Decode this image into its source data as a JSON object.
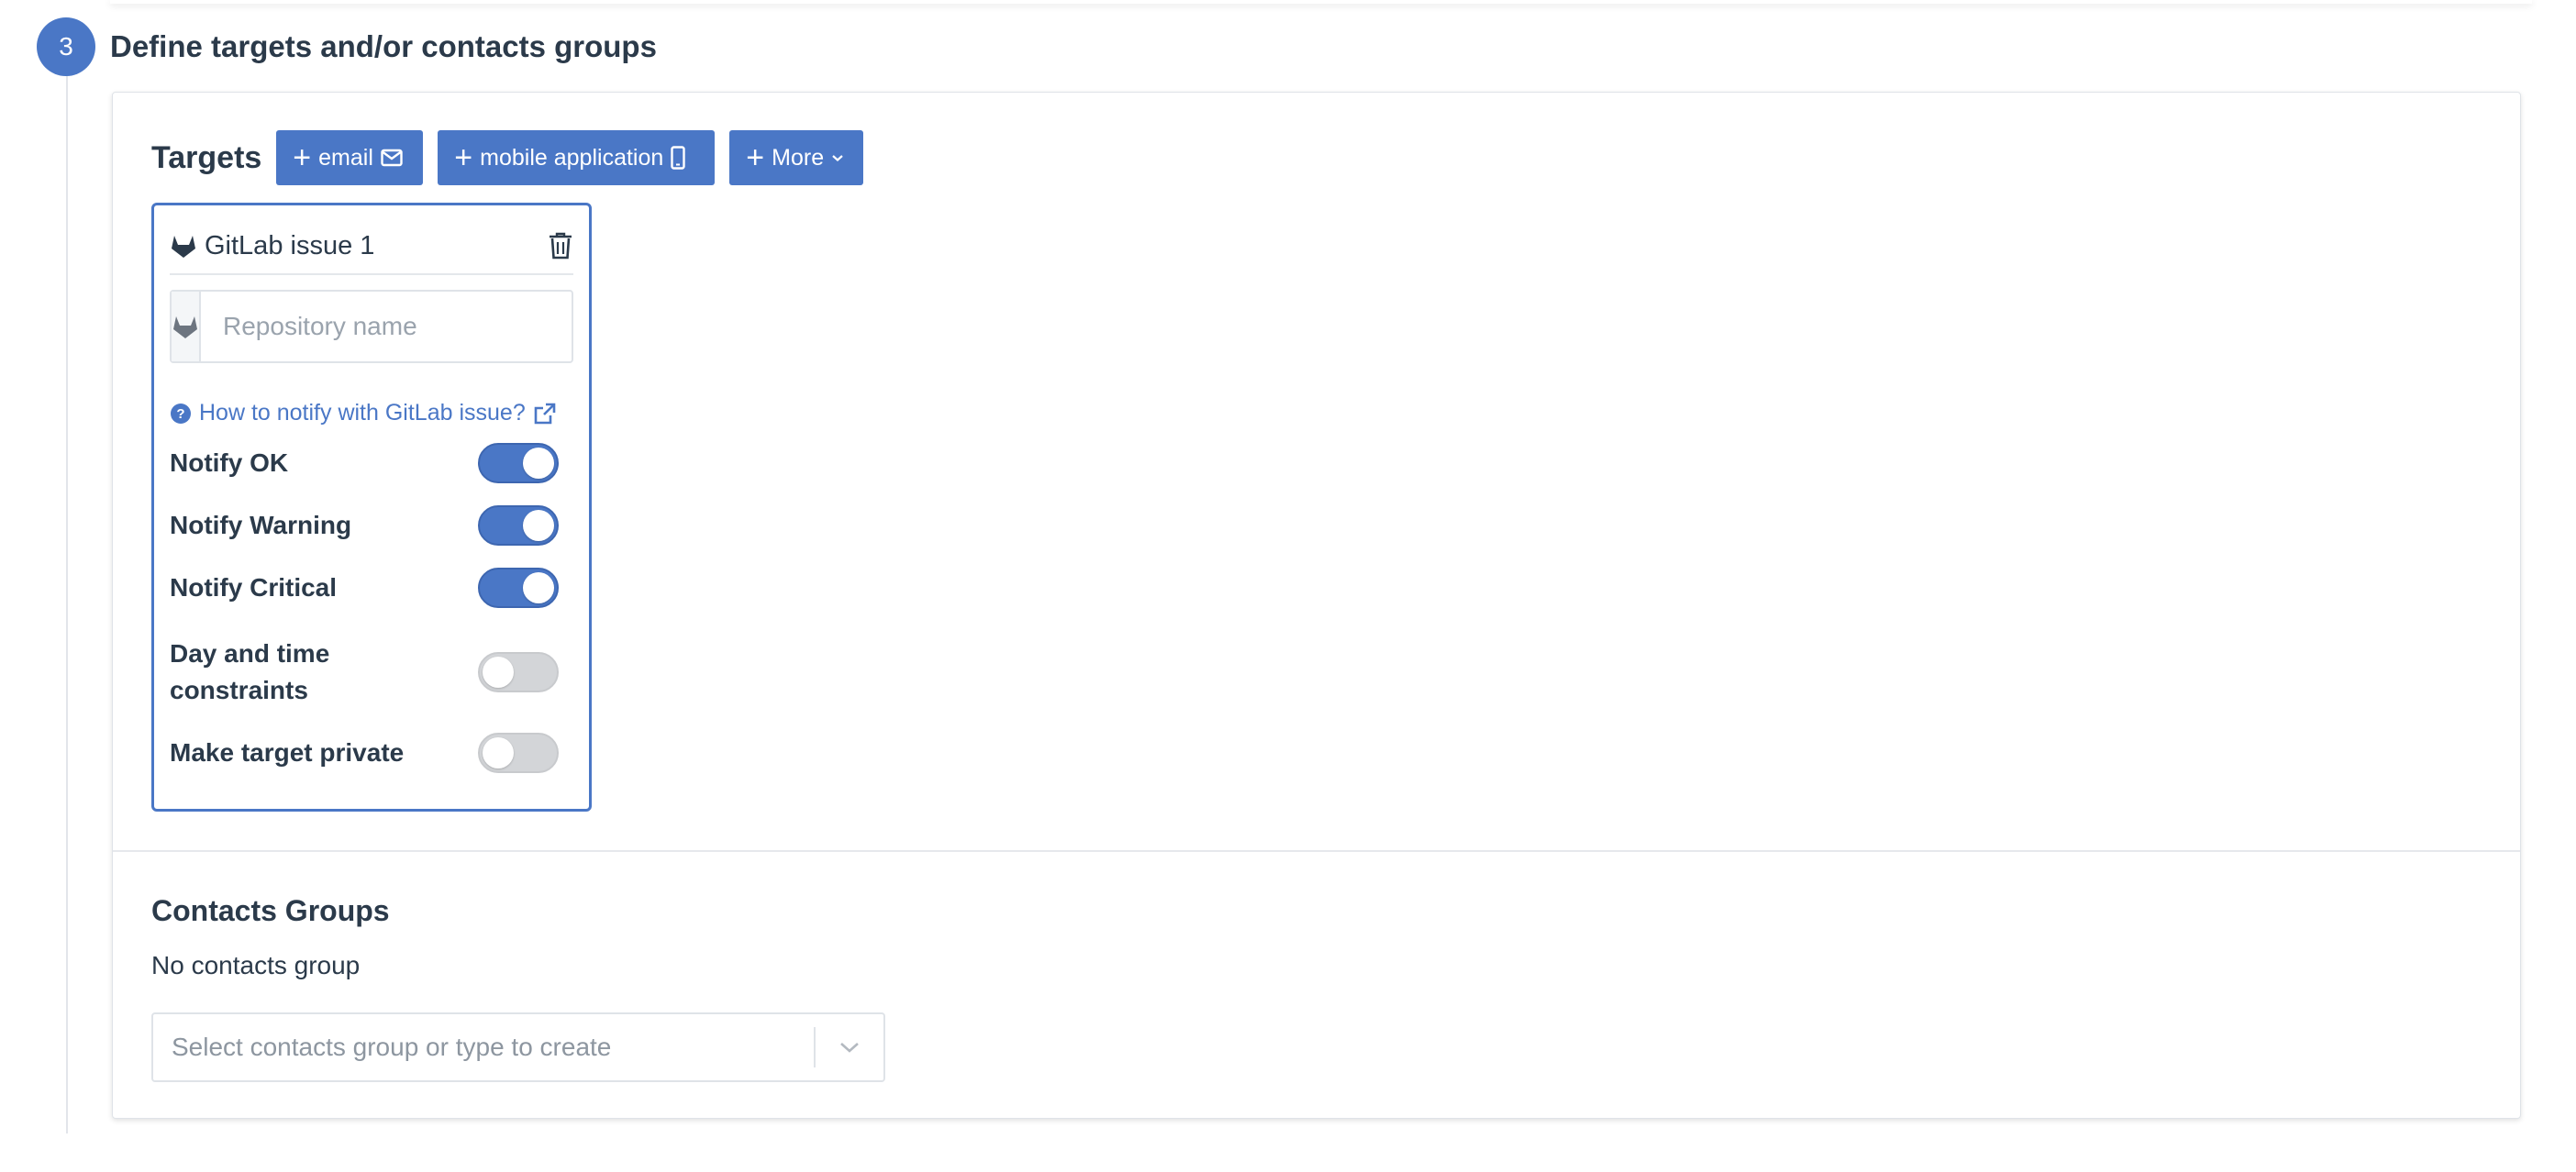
{
  "step": {
    "number": "3",
    "title": "Define targets and/or contacts groups"
  },
  "targets": {
    "title": "Targets",
    "buttons": {
      "email": "email",
      "mobile": "mobile application",
      "more": "More"
    },
    "card": {
      "title": "GitLab issue 1",
      "repository_placeholder": "Repository name",
      "help_link": "How to notify with GitLab issue?",
      "options": [
        {
          "label": "Notify OK",
          "enabled": true
        },
        {
          "label": "Notify Warning",
          "enabled": true
        },
        {
          "label": "Notify Critical",
          "enabled": true
        },
        {
          "label": "Day and time constraints",
          "enabled": false
        },
        {
          "label": "Make target private",
          "enabled": false
        }
      ]
    }
  },
  "contacts": {
    "title": "Contacts Groups",
    "empty_text": "No contacts group",
    "select_placeholder": "Select contacts group or type to create"
  },
  "colors": {
    "accent": "#4a77c6",
    "text": "#2b3a4a",
    "toggle_off": "#d3d5d8"
  },
  "icons": {
    "gitlab": "gitlab-icon",
    "trash": "trash-icon",
    "help": "question-circle-icon",
    "external": "external-link-icon",
    "email": "envelope-icon",
    "mobile": "mobile-phone-icon",
    "chevron": "chevron-down-icon"
  }
}
